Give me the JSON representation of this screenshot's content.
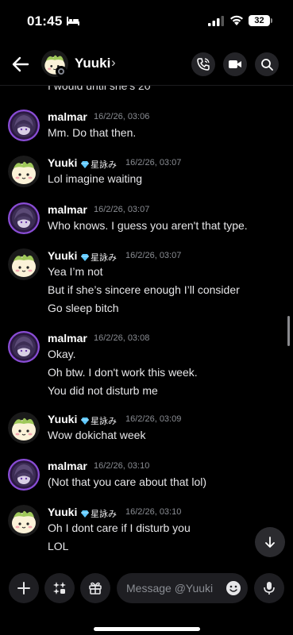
{
  "status_bar": {
    "time": "01:45",
    "battery": "32"
  },
  "header": {
    "contact_name": "Yuuki",
    "chevron": "›"
  },
  "messages": {
    "cut_text": "I would until she's 20",
    "items": [
      {
        "user": "malmar",
        "badge": "",
        "timestamp": "16/2/26, 03:06",
        "lines": [
          "Mm. Do that then."
        ]
      },
      {
        "user": "Yuuki",
        "badge": "星詠み",
        "timestamp": "16/2/26, 03:07",
        "lines": [
          "Lol imagine waiting"
        ]
      },
      {
        "user": "malmar",
        "badge": "",
        "timestamp": "16/2/26, 03:07",
        "lines": [
          "Who knows. I guess you aren't that type."
        ]
      },
      {
        "user": "Yuuki",
        "badge": "星詠み",
        "timestamp": "16/2/26, 03:07",
        "lines": [
          "Yea I’m not",
          "But if she’s sincere enough I’ll consider",
          "Go sleep bitch"
        ]
      },
      {
        "user": "malmar",
        "badge": "",
        "timestamp": "16/2/26, 03:08",
        "lines": [
          "Okay.",
          "Oh btw. I don't work this week.",
          "You did not disturb me"
        ]
      },
      {
        "user": "Yuuki",
        "badge": "星詠み",
        "timestamp": "16/2/26, 03:09",
        "lines": [
          "Wow dokichat week"
        ]
      },
      {
        "user": "malmar",
        "badge": "",
        "timestamp": "16/2/26, 03:10",
        "lines": [
          "(Not that you care about that lol)"
        ]
      },
      {
        "user": "Yuuki",
        "badge": "星詠み",
        "timestamp": "16/2/26, 03:10",
        "lines": [
          "Oh I dont care if I disturb you",
          "LOL"
        ]
      }
    ]
  },
  "composer": {
    "placeholder": "Message @Yuuki"
  },
  "icons": {
    "back": "arrow-left-icon",
    "call": "phone-icon",
    "video": "video-camera-icon",
    "search": "search-icon",
    "add": "plus-icon",
    "apps": "apps-sparkle-icon",
    "gift": "gift-icon",
    "emoji": "emoji-icon",
    "mic": "microphone-icon",
    "jump": "arrow-down-icon"
  },
  "colors": {
    "background": "#000000",
    "timestamp": "#8a8d93",
    "surface": "#1e1e22",
    "badge_gem": "#5cc8ff"
  }
}
